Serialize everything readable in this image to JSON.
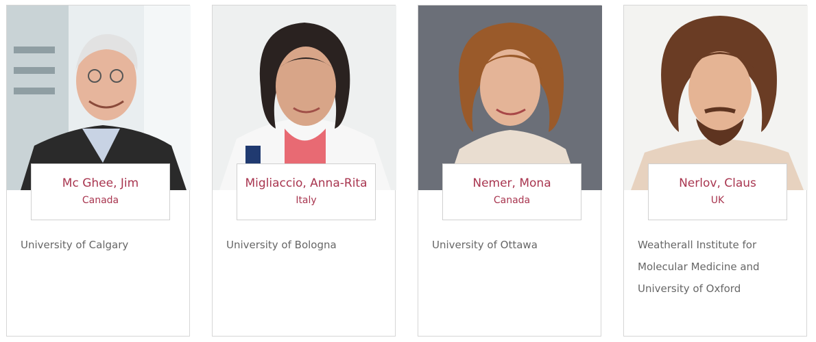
{
  "people": [
    {
      "name": "Mc Ghee, Jim",
      "country": "Canada",
      "affiliation": "University of Calgary"
    },
    {
      "name": "Migliaccio, Anna-Rita",
      "country": "Italy",
      "affiliation": "University of Bologna"
    },
    {
      "name": "Nemer, Mona",
      "country": "Canada",
      "affiliation": "University of Ottawa"
    },
    {
      "name": "Nerlov, Claus",
      "country": "UK",
      "affiliation": "Weatherall Institute for Molecular Medicine and University of Oxford"
    }
  ],
  "colors": {
    "accent": "#a8354f",
    "body_text": "#666666",
    "card_border": "#d6d6d6"
  }
}
